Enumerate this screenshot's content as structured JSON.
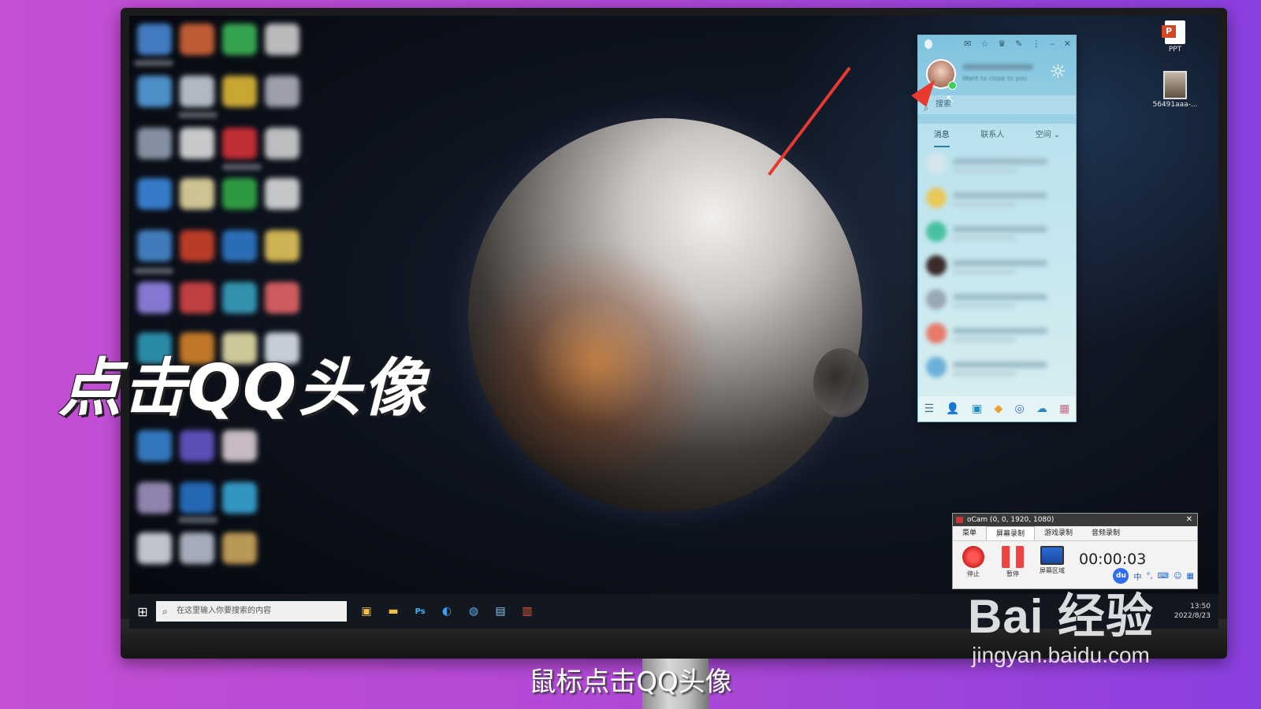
{
  "overlay": {
    "title": "点击QQ头像",
    "subtitle": "鼠标点击QQ头像"
  },
  "watermark": {
    "logo": "Bai  经验",
    "url": "jingyan.baidu.com"
  },
  "desktop_right": {
    "items": [
      {
        "icon": "ppt-file-icon",
        "label": "PPT",
        "badge": "P"
      },
      {
        "icon": "image-file-icon",
        "label": "56491aaa-..."
      }
    ]
  },
  "qq": {
    "signature": "Want to close to you",
    "search_placeholder": "搜索",
    "tabs": [
      "消息",
      "联系人",
      "空间 ⌄"
    ],
    "controls": [
      "✉",
      "☆",
      "♛",
      "✎",
      "⋮",
      "–",
      "✕"
    ]
  },
  "ocam": {
    "title": "oCam (0, 0, 1920, 1080)",
    "close": "✕",
    "tabs": [
      "菜单",
      "屏幕录制",
      "游戏录制",
      "音频录制"
    ],
    "buttons": {
      "stop": "停止",
      "pause": "暂停",
      "screen": "屏幕区域"
    },
    "timer": "00:00:03",
    "ime": {
      "baidu": "du",
      "mode": "中"
    }
  },
  "taskbar": {
    "search_placeholder": "在这里输入你要搜索的内容",
    "time": "13:50",
    "date": "2022/8/23"
  },
  "colors": {
    "background": "#b048d6",
    "arrow": "#e8392f",
    "qq_accent": "#7fc3df"
  }
}
